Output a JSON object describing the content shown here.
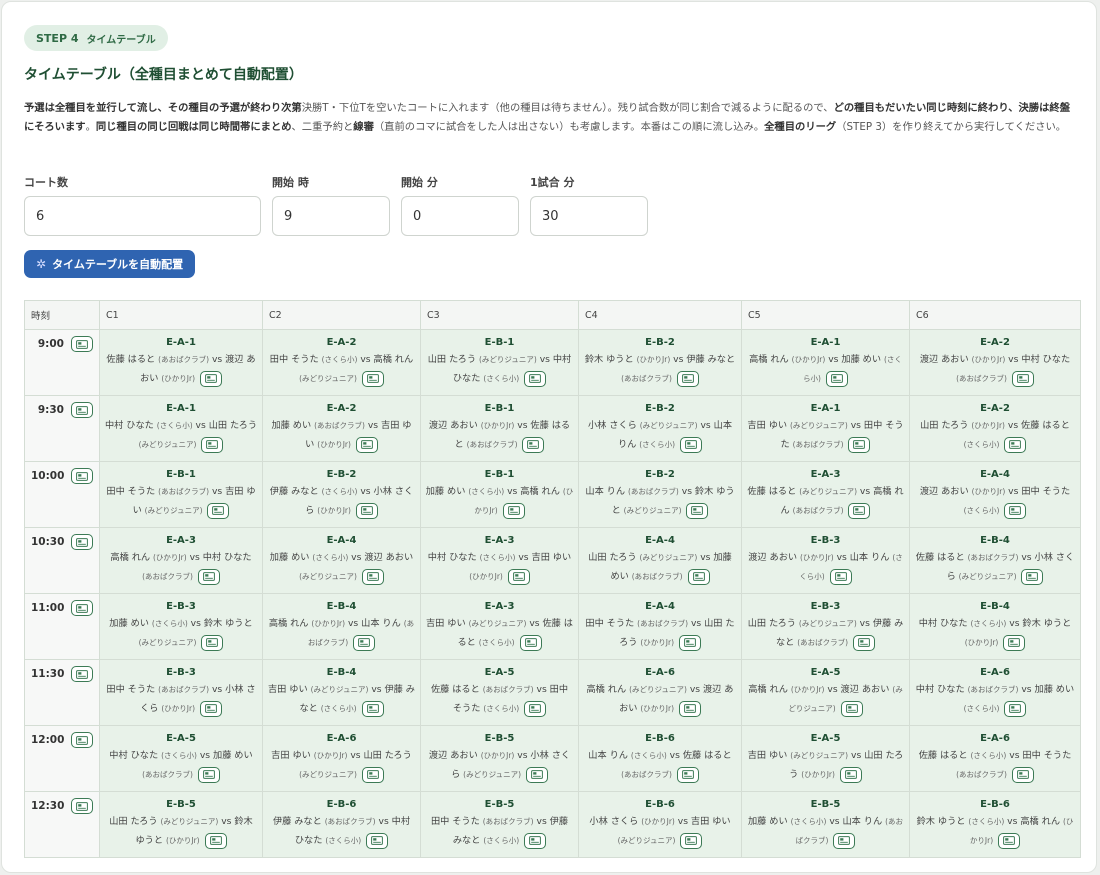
{
  "step": {
    "label": "STEP 4",
    "sub": "タイムテーブル"
  },
  "title": "タイムテーブル（全種目まとめて自動配置）",
  "description": [
    {
      "t": "予選は全種目を並行して流し、その種目の予選が終わり次第",
      "b": true
    },
    {
      "t": "決勝T・下位Tを空いたコートに入れます（他の種目は待ちません）。残り試合数が同じ割合で減るように配るので、",
      "b": false
    },
    {
      "t": "どの種目もだいたい同じ時刻に終わり、決勝は終盤にそろいます",
      "b": true
    },
    {
      "t": "。",
      "b": false
    },
    {
      "t": "同じ種目の同じ回戦は同じ時間帯にまとめ",
      "b": true
    },
    {
      "t": "、二重予約と",
      "b": false
    },
    {
      "t": "線審",
      "b": true
    },
    {
      "t": "（直前のコマに試合をした人は出さない）も考慮します。本番はこの順に流し込み。",
      "b": false
    },
    {
      "t": "全種目のリーグ",
      "b": true
    },
    {
      "t": "（STEP 3）を作り終えてから実行してください。",
      "b": false
    }
  ],
  "fields": {
    "courts": {
      "label": "コート数",
      "value": "6"
    },
    "start_hour": {
      "label": "開始 時",
      "value": "9"
    },
    "start_min": {
      "label": "開始 分",
      "value": "0"
    },
    "match_min": {
      "label": "1試合 分",
      "value": "30"
    }
  },
  "run_button": "タイムテーブルを自動配置",
  "icons": {
    "gear": "gear-icon",
    "slot": "image-card-icon"
  },
  "colors": {
    "accent": "#2f64b1",
    "green": "#3c7a55",
    "slot_bg": "#e8f2e9"
  },
  "table": {
    "time_header": "時刻",
    "courts": [
      "C1",
      "C2",
      "C3",
      "C4",
      "C5",
      "C6"
    ],
    "rows": [
      {
        "time": "9:00",
        "slots": [
          {
            "code": "E-A-1",
            "p1": "佐藤 はると",
            "c1": "(あおばクラブ)",
            "p2": "渡辺 あおい",
            "c2": "(ひかりJr)"
          },
          {
            "code": "E-A-2",
            "p1": "田中 そうた",
            "c1": "(さくら小)",
            "p2": "高橋 れん",
            "c2": "(みどりジュニア)"
          },
          {
            "code": "E-B-1",
            "p1": "山田 たろう",
            "c1": "(みどりジュニア)",
            "p2": "中村 ひなた",
            "c2": "(さくら小)"
          },
          {
            "code": "E-B-2",
            "p1": "鈴木 ゆうと",
            "c1": "(ひかりJr)",
            "p2": "伊藤 みなと",
            "c2": "(あおばクラブ)"
          },
          {
            "code": "E-A-1",
            "p1": "高橋 れん",
            "c1": "(ひかりJr)",
            "p2": "加藤 めい",
            "c2": "(さくら小)"
          },
          {
            "code": "E-A-2",
            "p1": "渡辺 あおい",
            "c1": "(ひかりJr)",
            "p2": "中村 ひなた",
            "c2": "(あおばクラブ)"
          }
        ]
      },
      {
        "time": "9:30",
        "slots": [
          {
            "code": "E-A-1",
            "p1": "中村 ひなた",
            "c1": "(さくら小)",
            "p2": "山田 たろう",
            "c2": "(みどりジュニア)"
          },
          {
            "code": "E-A-2",
            "p1": "加藤 めい",
            "c1": "(あおばクラブ)",
            "p2": "吉田 ゆい",
            "c2": "(ひかりJr)"
          },
          {
            "code": "E-B-1",
            "p1": "渡辺 あおい",
            "c1": "(ひかりJr)",
            "p2": "佐藤 はると",
            "c2": "(あおばクラブ)"
          },
          {
            "code": "E-B-2",
            "p1": "小林 さくら",
            "c1": "(みどりジュニア)",
            "p2": "山本 りん",
            "c2": "(さくら小)"
          },
          {
            "code": "E-A-1",
            "p1": "吉田 ゆい",
            "c1": "(みどりジュニア)",
            "p2": "田中 そうた",
            "c2": "(あおばクラブ)"
          },
          {
            "code": "E-A-2",
            "p1": "山田 たろう",
            "c1": "(ひかりJr)",
            "p2": "佐藤 はると",
            "c2": "(さくら小)"
          }
        ]
      },
      {
        "time": "10:00",
        "slots": [
          {
            "code": "E-B-1",
            "p1": "田中 そうた",
            "c1": "(あおばクラブ)",
            "p2": "吉田 ゆい",
            "c2": "(みどりジュニア)"
          },
          {
            "code": "E-B-2",
            "p1": "伊藤 みなと",
            "c1": "(さくら小)",
            "p2": "小林 さくら",
            "c2": "(ひかりJr)"
          },
          {
            "code": "E-B-1",
            "p1": "加藤 めい",
            "c1": "(さくら小)",
            "p2": "高橋 れん",
            "c2": "(ひかりJr)"
          },
          {
            "code": "E-B-2",
            "p1": "山本 りん",
            "c1": "(あおばクラブ)",
            "p2": "鈴木 ゆうと",
            "c2": "(みどりジュニア)"
          },
          {
            "code": "E-A-3",
            "p1": "佐藤 はると",
            "c1": "(みどりジュニア)",
            "p2": "高橋 れん",
            "c2": "(あおばクラブ)"
          },
          {
            "code": "E-A-4",
            "p1": "渡辺 あおい",
            "c1": "(ひかりJr)",
            "p2": "田中 そうた",
            "c2": "(さくら小)"
          }
        ]
      },
      {
        "time": "10:30",
        "slots": [
          {
            "code": "E-A-3",
            "p1": "高橋 れん",
            "c1": "(ひかりJr)",
            "p2": "中村 ひなた",
            "c2": "(あおばクラブ)"
          },
          {
            "code": "E-A-4",
            "p1": "加藤 めい",
            "c1": "(さくら小)",
            "p2": "渡辺 あおい",
            "c2": "(みどりジュニア)"
          },
          {
            "code": "E-A-3",
            "p1": "中村 ひなた",
            "c1": "(さくら小)",
            "p2": "吉田 ゆい",
            "c2": "(ひかりJr)"
          },
          {
            "code": "E-A-4",
            "p1": "山田 たろう",
            "c1": "(みどりジュニア)",
            "p2": "加藤 めい",
            "c2": "(あおばクラブ)"
          },
          {
            "code": "E-B-3",
            "p1": "渡辺 あおい",
            "c1": "(ひかりJr)",
            "p2": "山本 りん",
            "c2": "(さくら小)"
          },
          {
            "code": "E-B-4",
            "p1": "佐藤 はると",
            "c1": "(あおばクラブ)",
            "p2": "小林 さくら",
            "c2": "(みどりジュニア)"
          }
        ]
      },
      {
        "time": "11:00",
        "slots": [
          {
            "code": "E-B-3",
            "p1": "加藤 めい",
            "c1": "(さくら小)",
            "p2": "鈴木 ゆうと",
            "c2": "(みどりジュニア)"
          },
          {
            "code": "E-B-4",
            "p1": "高橋 れん",
            "c1": "(ひかりJr)",
            "p2": "山本 りん",
            "c2": "(あおばクラブ)"
          },
          {
            "code": "E-A-3",
            "p1": "吉田 ゆい",
            "c1": "(みどりジュニア)",
            "p2": "佐藤 はると",
            "c2": "(さくら小)"
          },
          {
            "code": "E-A-4",
            "p1": "田中 そうた",
            "c1": "(あおばクラブ)",
            "p2": "山田 たろう",
            "c2": "(ひかりJr)"
          },
          {
            "code": "E-B-3",
            "p1": "山田 たろう",
            "c1": "(みどりジュニア)",
            "p2": "伊藤 みなと",
            "c2": "(あおばクラブ)"
          },
          {
            "code": "E-B-4",
            "p1": "中村 ひなた",
            "c1": "(さくら小)",
            "p2": "鈴木 ゆうと",
            "c2": "(ひかりJr)"
          }
        ]
      },
      {
        "time": "11:30",
        "slots": [
          {
            "code": "E-B-3",
            "p1": "田中 そうた",
            "c1": "(あおばクラブ)",
            "p2": "小林 さくら",
            "c2": "(ひかりJr)"
          },
          {
            "code": "E-B-4",
            "p1": "吉田 ゆい",
            "c1": "(みどりジュニア)",
            "p2": "伊藤 みなと",
            "c2": "(さくら小)"
          },
          {
            "code": "E-A-5",
            "p1": "佐藤 はると",
            "c1": "(あおばクラブ)",
            "p2": "田中 そうた",
            "c2": "(さくら小)"
          },
          {
            "code": "E-A-6",
            "p1": "高橋 れん",
            "c1": "(みどりジュニア)",
            "p2": "渡辺 あおい",
            "c2": "(ひかりJr)"
          },
          {
            "code": "E-A-5",
            "p1": "高橋 れん",
            "c1": "(ひかりJr)",
            "p2": "渡辺 あおい",
            "c2": "(みどりジュニア)"
          },
          {
            "code": "E-A-6",
            "p1": "中村 ひなた",
            "c1": "(あおばクラブ)",
            "p2": "加藤 めい",
            "c2": "(さくら小)"
          }
        ]
      },
      {
        "time": "12:00",
        "slots": [
          {
            "code": "E-A-5",
            "p1": "中村 ひなた",
            "c1": "(さくら小)",
            "p2": "加藤 めい",
            "c2": "(あおばクラブ)"
          },
          {
            "code": "E-A-6",
            "p1": "吉田 ゆい",
            "c1": "(ひかりJr)",
            "p2": "山田 たろう",
            "c2": "(みどりジュニア)"
          },
          {
            "code": "E-B-5",
            "p1": "渡辺 あおい",
            "c1": "(ひかりJr)",
            "p2": "小林 さくら",
            "c2": "(みどりジュニア)"
          },
          {
            "code": "E-B-6",
            "p1": "山本 りん",
            "c1": "(さくら小)",
            "p2": "佐藤 はると",
            "c2": "(あおばクラブ)"
          },
          {
            "code": "E-A-5",
            "p1": "吉田 ゆい",
            "c1": "(みどりジュニア)",
            "p2": "山田 たろう",
            "c2": "(ひかりJr)"
          },
          {
            "code": "E-A-6",
            "p1": "佐藤 はると",
            "c1": "(さくら小)",
            "p2": "田中 そうた",
            "c2": "(あおばクラブ)"
          }
        ]
      },
      {
        "time": "12:30",
        "slots": [
          {
            "code": "E-B-5",
            "p1": "山田 たろう",
            "c1": "(みどりジュニア)",
            "p2": "鈴木 ゆうと",
            "c2": "(ひかりJr)"
          },
          {
            "code": "E-B-6",
            "p1": "伊藤 みなと",
            "c1": "(あおばクラブ)",
            "p2": "中村 ひなた",
            "c2": "(さくら小)"
          },
          {
            "code": "E-B-5",
            "p1": "田中 そうた",
            "c1": "(あおばクラブ)",
            "p2": "伊藤 みなと",
            "c2": "(さくら小)"
          },
          {
            "code": "E-B-6",
            "p1": "小林 さくら",
            "c1": "(ひかりJr)",
            "p2": "吉田 ゆい",
            "c2": "(みどりジュニア)"
          },
          {
            "code": "E-B-5",
            "p1": "加藤 めい",
            "c1": "(さくら小)",
            "p2": "山本 りん",
            "c2": "(あおばクラブ)"
          },
          {
            "code": "E-B-6",
            "p1": "鈴木 ゆうと",
            "c1": "(さくら小)",
            "p2": "高橋 れん",
            "c2": "(ひかりJr)"
          }
        ]
      }
    ]
  }
}
